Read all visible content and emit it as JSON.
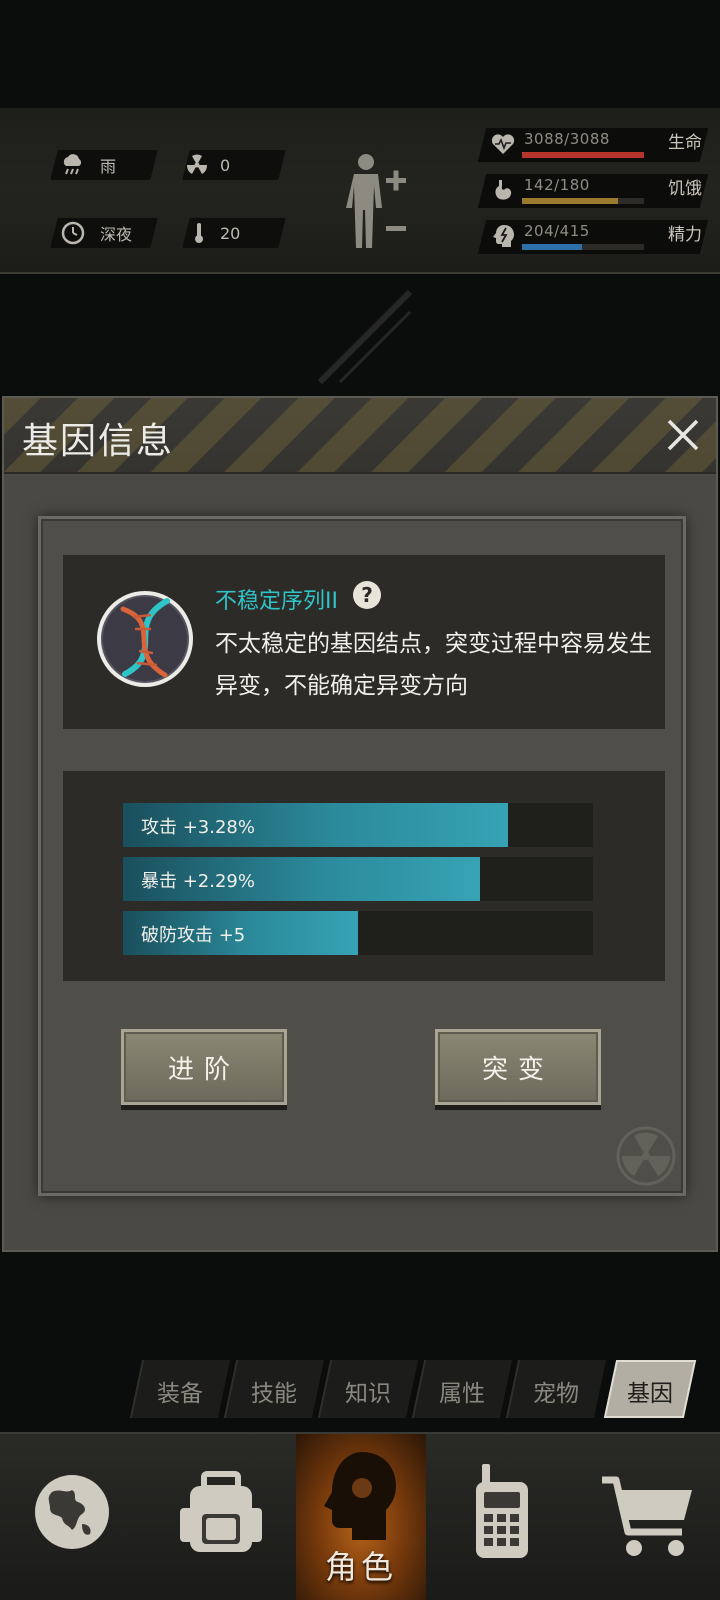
{
  "status": {
    "weather": {
      "icon": "rain-cloud-icon",
      "label": "雨"
    },
    "radiation": {
      "icon": "radiation-icon",
      "value": "0"
    },
    "time": {
      "icon": "clock-icon",
      "label": "深夜"
    },
    "temperature": {
      "icon": "thermometer-icon",
      "value": "20"
    },
    "stats": [
      {
        "icon": "heart-pulse-icon",
        "value": "3088/3088",
        "name": "生命",
        "percent": 100,
        "color": "#b8342a"
      },
      {
        "icon": "stomach-icon",
        "value": "142/180",
        "name": "饥饿",
        "percent": 79,
        "color": "#9a7a2c"
      },
      {
        "icon": "energy-head-icon",
        "value": "204/415",
        "name": "精力",
        "percent": 49,
        "color": "#2d6fa8"
      }
    ]
  },
  "dialog": {
    "title": "基因信息",
    "gene": {
      "name": "不稳定序列II",
      "description": "不太稳定的基因结点，突变过程中容易发生异变，不能确定异变方向"
    },
    "attributes": [
      {
        "label": "攻击 +3.28%",
        "percent": 82
      },
      {
        "label": "暴击 +2.29%",
        "percent": 76
      },
      {
        "label": "破防攻击 +5",
        "percent": 50
      }
    ],
    "buttons": {
      "advance": "进阶",
      "mutate": "突变"
    }
  },
  "tabs": [
    {
      "label": "装备",
      "active": false
    },
    {
      "label": "技能",
      "active": false
    },
    {
      "label": "知识",
      "active": false
    },
    {
      "label": "属性",
      "active": false
    },
    {
      "label": "宠物",
      "active": false
    },
    {
      "label": "基因",
      "active": true
    }
  ],
  "nav": {
    "items": [
      {
        "icon": "globe-icon",
        "label": ""
      },
      {
        "icon": "backpack-icon",
        "label": ""
      },
      {
        "icon": "character-head-icon",
        "label": "角色",
        "active": true
      },
      {
        "icon": "walkie-talkie-icon",
        "label": ""
      },
      {
        "icon": "shopping-cart-icon",
        "label": ""
      }
    ]
  }
}
